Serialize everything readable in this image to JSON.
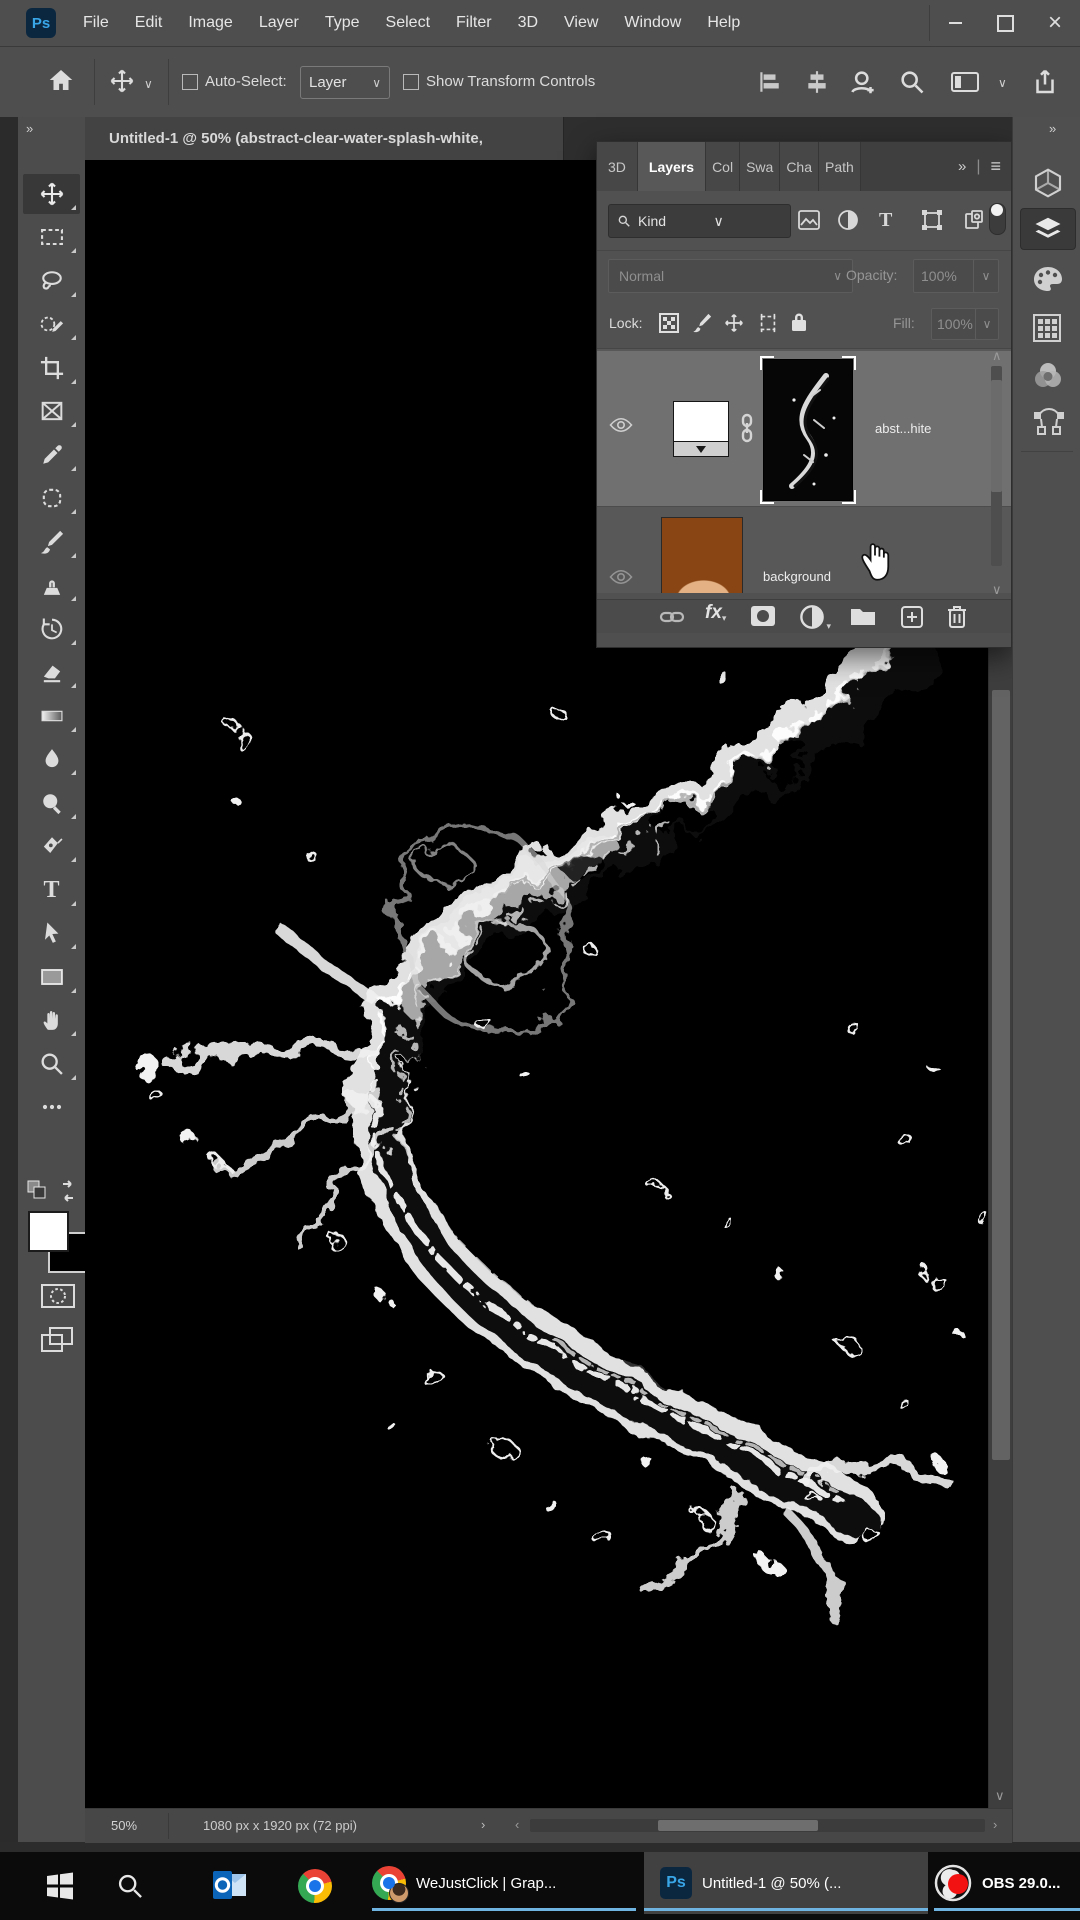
{
  "app": {
    "logo_text": "Ps"
  },
  "menubar": {
    "menus": [
      "File",
      "Edit",
      "Image",
      "Layer",
      "Type",
      "Select",
      "Filter",
      "3D",
      "View",
      "Window",
      "Help"
    ]
  },
  "options_bar": {
    "auto_select_label": "Auto-Select:",
    "layer_select_value": "Layer",
    "show_transform_controls_label": "Show Transform Controls"
  },
  "document_tab": {
    "title": "Untitled-1 @ 50% (abstract-clear-water-splash-white,"
  },
  "layers_panel": {
    "tabs": [
      "3D",
      "Layers",
      "Col",
      "Swa",
      "Cha",
      "Path"
    ],
    "active_tab": "Layers",
    "collapse_glyph": "»",
    "divider_glyph": "|",
    "panel_menu_glyph": "≡",
    "kind_label": "Kind",
    "blend_mode": "Normal",
    "opacity_label": "Opacity:",
    "opacity_value": "100%",
    "lock_label": "Lock:",
    "fill_label": "Fill:",
    "fill_value": "100%",
    "fx_label": "fx",
    "layers": [
      {
        "name": "abst...hite"
      },
      {
        "name": "background"
      }
    ],
    "scroll_up_glyph": "∧",
    "scroll_down_glyph": "∨"
  },
  "toolbar": {
    "expand_glyph": "»"
  },
  "right_dock": {
    "expand_glyph": "»"
  },
  "canvas_scroll": {
    "down_glyph": "∨"
  },
  "status_bar": {
    "zoom_level": "50%",
    "doc_info": "1080 px x 1920 px (72 ppi)",
    "chev_right": "›",
    "chev_left": "‹"
  },
  "taskbar": {
    "buttons": [
      {
        "label": "WeJustClick | Grap..."
      },
      {
        "label": "Untitled-1 @ 50% (..."
      },
      {
        "label": "OBS 29.0..."
      }
    ]
  },
  "colors": {
    "accent_blue": "#39a6e8",
    "taskbar_underline": "#6fb3e0"
  }
}
